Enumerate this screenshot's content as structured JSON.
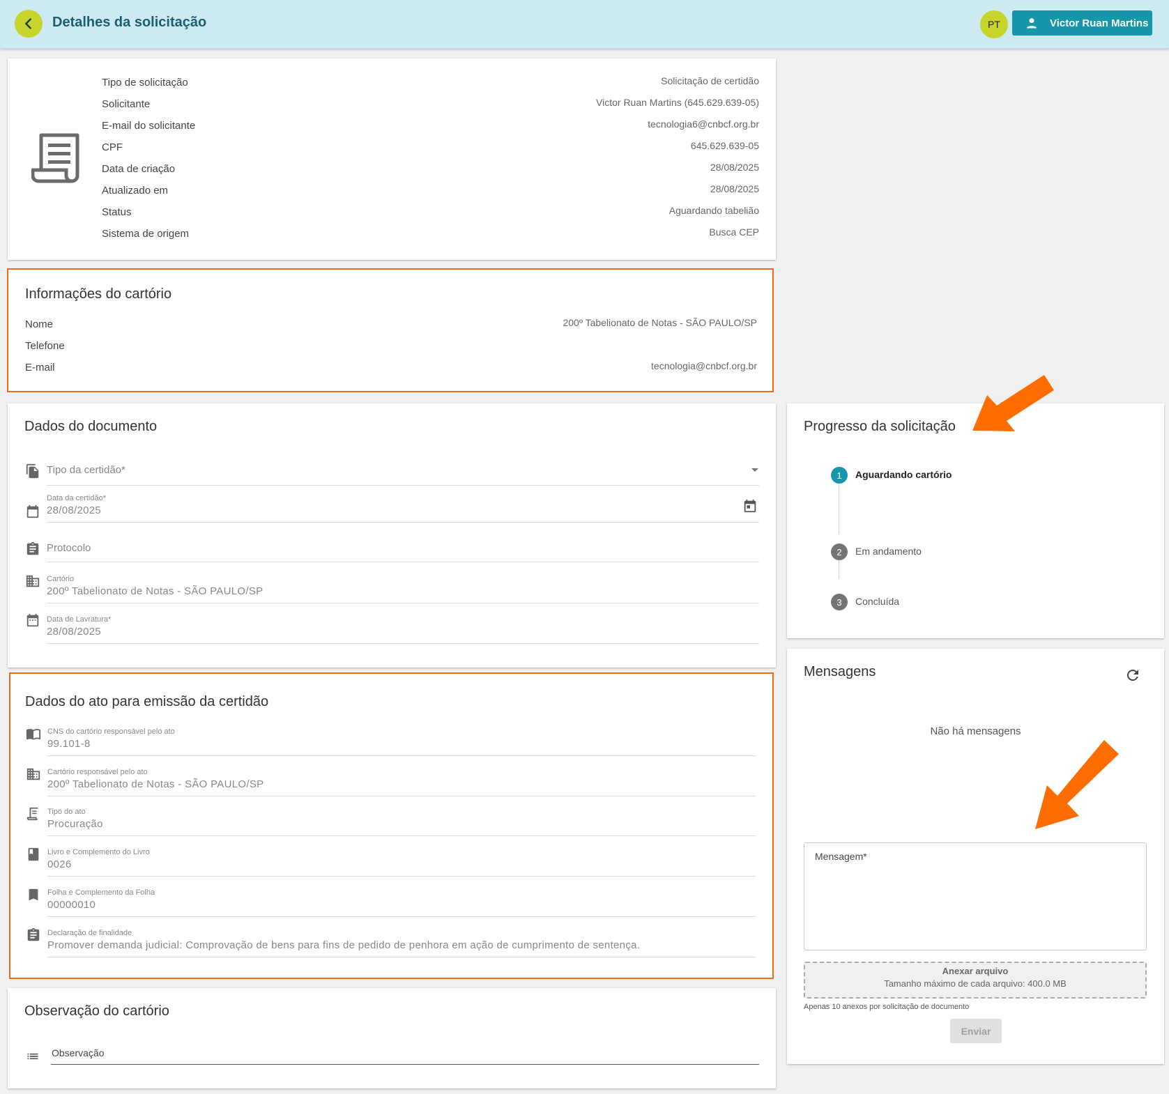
{
  "header": {
    "title": "Detalhes da solicitação",
    "avatar_initials": "PT",
    "user_name": "Victor Ruan Martins"
  },
  "summary": {
    "rows": [
      {
        "label": "Tipo de solicitação",
        "value": "Solicitação de certidão"
      },
      {
        "label": "Solicitante",
        "value": "Victor Ruan Martins (645.629.639-05)"
      },
      {
        "label": "E-mail do solicitante",
        "value": "tecnologia6@cnbcf.org.br"
      },
      {
        "label": "CPF",
        "value": "645.629.639-05"
      },
      {
        "label": "Data de criação",
        "value": "28/08/2025"
      },
      {
        "label": "Atualizado em",
        "value": "28/08/2025"
      },
      {
        "label": "Status",
        "value": "Aguardando tabelião"
      },
      {
        "label": "Sistema de origem",
        "value": "Busca CEP"
      }
    ]
  },
  "cartorio_info": {
    "title": "Informações do cartório",
    "rows": [
      {
        "label": "Nome",
        "value": "200º Tabelionato de Notas - SÃO PAULO/SP"
      },
      {
        "label": "Telefone",
        "value": ""
      },
      {
        "label": "E-mail",
        "value": "tecnologia@cnbcf.org.br"
      }
    ]
  },
  "documento": {
    "title": "Dados do documento",
    "tipo_certidao_placeholder": "Tipo da certidão*",
    "data_certidao_label": "Data da certidão*",
    "data_certidao_value": "28/08/2025",
    "protocolo_placeholder": "Protocolo",
    "cartorio_label": "Cartório",
    "cartorio_value": "200º Tabelionato de Notas - SÃO PAULO/SP",
    "data_lavratura_label": "Data de Lavratura*",
    "data_lavratura_value": "28/08/2025"
  },
  "ato": {
    "title": "Dados do ato para emissão da certidão",
    "cns_label": "CNS do cartório responsável pelo ato",
    "cns_value": "99.101-8",
    "cartorio_label": "Cartório responsável pelo ato",
    "cartorio_value": "200º Tabelionato de Notas - SÃO PAULO/SP",
    "tipo_label": "Tipo do ato",
    "tipo_value": "Procuração",
    "livro_label": "Livro e Complemento do Livro",
    "livro_value": "0026",
    "folha_label": "Folha e Complemento da Folha",
    "folha_value": "00000010",
    "declaracao_label": "Declaração de finalidade",
    "declaracao_value": "Promover demanda judicial: Comprovação de bens para fins de pedido de penhora em ação de cumprimento de sentença."
  },
  "observacao": {
    "title": "Observação do cartório",
    "placeholder": "Observação"
  },
  "progresso": {
    "title": "Progresso da solicitação",
    "steps": [
      {
        "number": "1",
        "label": "Aguardando cartório",
        "active": true
      },
      {
        "number": "2",
        "label": "Em andamento",
        "active": false
      },
      {
        "number": "3",
        "label": "Concluída",
        "active": false
      }
    ]
  },
  "mensagens": {
    "title": "Mensagens",
    "empty_text": "Não há mensagens",
    "message_label": "Mensagem*",
    "attach_title": "Anexar arquivo",
    "attach_subtitle": "Tamanho máximo de cada arquivo: 400.0 MB",
    "attach_hint": "Apenas 10 anexos por solicitação de documento",
    "send_label": "Enviar"
  },
  "colors": {
    "header_bg": "#cdeaf0",
    "accent": "#1597a9",
    "lime": "#c6d42c",
    "highlight_orange": "#f06a18",
    "arrow_orange": "#ff6d00"
  }
}
